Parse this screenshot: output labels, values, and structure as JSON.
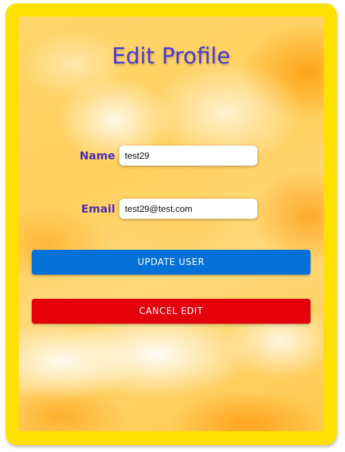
{
  "title": "Edit Profile",
  "form": {
    "name_label": "Name",
    "name_value": "test29",
    "email_label": "Email",
    "email_value": "test29@test.com"
  },
  "buttons": {
    "update_label": "UPDATE USER",
    "cancel_label": "CANCEL EDIT"
  },
  "colors": {
    "frame": "#ffe000",
    "title": "#4a3ad6",
    "label": "#4e2fb3",
    "update_button": "#0571d8",
    "cancel_button": "#e3000b"
  }
}
